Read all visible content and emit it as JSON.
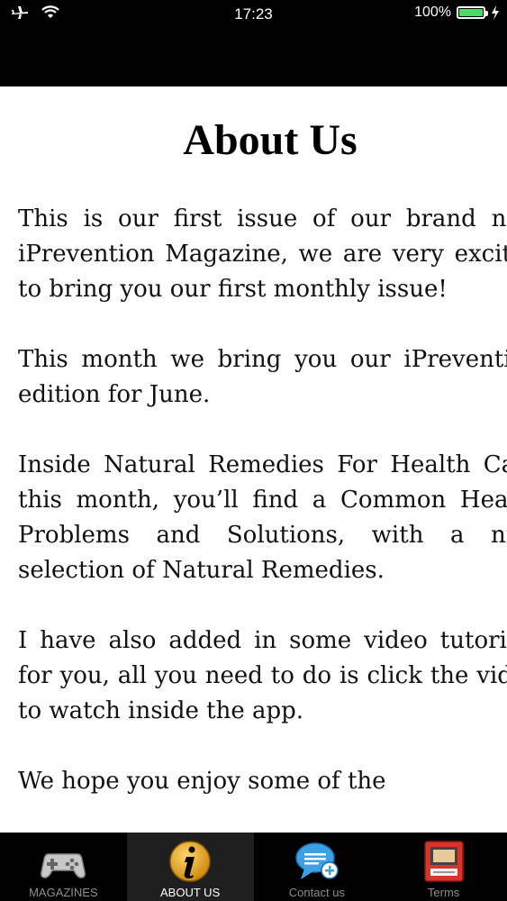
{
  "status_bar": {
    "time": "17:23",
    "battery": "100%"
  },
  "page": {
    "title": "About Us",
    "paragraphs": [
      "This is our first issue of our brand new iPrevention Magazine, we are very excited to bring you our first monthly issue!",
      "This month we bring you our iPrevention edition for June.",
      "Inside Natural Remedies For Health Care this month, you’ll find a Common Health Problems and Solutions, with a nice selection of Natural Remedies.",
      "I have also added in some video tutorials for you, all you need to do is click the video to watch inside the app.",
      "We hope you enjoy some of the"
    ]
  },
  "tabs": [
    {
      "label": "MAGAZINES",
      "icon": "gamepad-icon",
      "active": false
    },
    {
      "label": "ABOUT US",
      "icon": "info-icon",
      "active": true
    },
    {
      "label": "Contact us",
      "icon": "chat-bubble-icon",
      "active": false
    },
    {
      "label": "Terms",
      "icon": "document-icon",
      "active": false
    }
  ],
  "colors": {
    "battery": "#4cd964",
    "info_icon": "#e8a317",
    "chat_icon": "#3aa0e8",
    "terms_icon": "#d8352a"
  }
}
